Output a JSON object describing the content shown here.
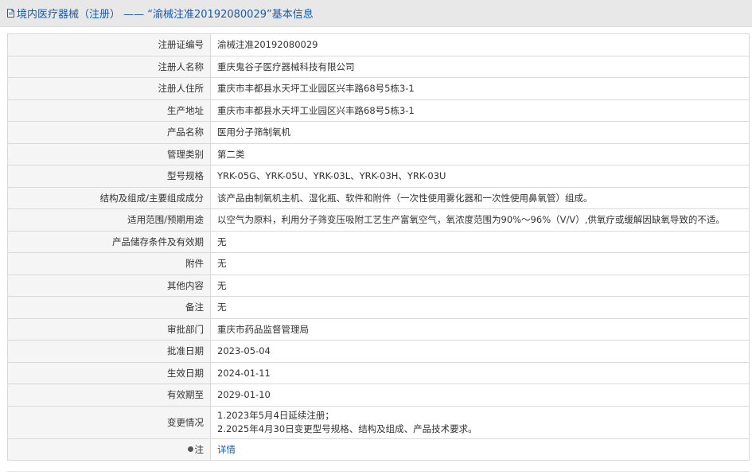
{
  "header": {
    "category": "境内医疗器械（注册）",
    "separator": " —— ",
    "reg_no_quoted": "“渝械注准20192080029”",
    "suffix": "基本信息"
  },
  "rows": [
    {
      "label": "注册证编号",
      "value": "渝械注准20192080029"
    },
    {
      "label": "注册人名称",
      "value": "重庆鬼谷子医疗器械科技有限公司"
    },
    {
      "label": "注册人住所",
      "value": "重庆市丰都县水天坪工业园区兴丰路68号5栋3-1"
    },
    {
      "label": "生产地址",
      "value": "重庆市丰都县水天坪工业园区兴丰路68号5栋3-1"
    },
    {
      "label": "产品名称",
      "value": "医用分子筛制氧机"
    },
    {
      "label": "管理类别",
      "value": "第二类"
    },
    {
      "label": "型号规格",
      "value": "YRK-05G、YRK-05U、YRK-03L、YRK-03H、YRK-03U"
    },
    {
      "label": "结构及组成/主要组成成分",
      "value": "该产品由制氧机主机、湿化瓶、软件和附件（一次性使用雾化器和一次性使用鼻氧管）组成。"
    },
    {
      "label": "适用范围/预期用途",
      "value": "以空气为原料，利用分子筛变压吸附工艺生产富氧空气，氧浓度范围为90%～96%（V/V）,供氧疗或缓解因缺氧导致的不适。"
    },
    {
      "label": "产品储存条件及有效期",
      "value": "无"
    },
    {
      "label": "附件",
      "value": "无"
    },
    {
      "label": "其他内容",
      "value": "无"
    },
    {
      "label": "备注",
      "value": "无"
    },
    {
      "label": "审批部门",
      "value": "重庆市药品监督管理局"
    },
    {
      "label": "批准日期",
      "value": "2023-05-04"
    },
    {
      "label": "生效日期",
      "value": "2024-01-11"
    },
    {
      "label": "有效期至",
      "value": "2029-01-10"
    }
  ],
  "change": {
    "label": "变更情况",
    "line1": "1.2023年5月4日延续注册；",
    "line2": "2.2025年4月30日变更型号规格、结构及组成、产品技术要求。"
  },
  "note": {
    "label": "注",
    "link_text": "详情"
  }
}
